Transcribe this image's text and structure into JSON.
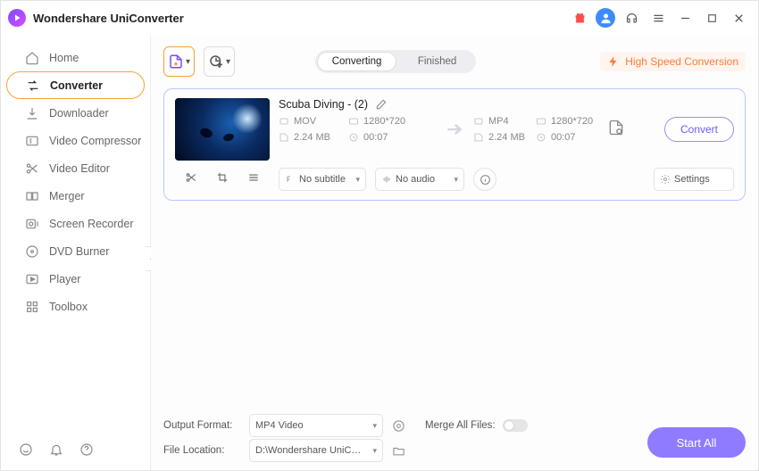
{
  "app": {
    "title": "Wondershare UniConverter"
  },
  "sidebar": {
    "items": [
      {
        "label": "Home"
      },
      {
        "label": "Converter"
      },
      {
        "label": "Downloader"
      },
      {
        "label": "Video Compressor"
      },
      {
        "label": "Video Editor"
      },
      {
        "label": "Merger"
      },
      {
        "label": "Screen Recorder"
      },
      {
        "label": "DVD Burner"
      },
      {
        "label": "Player"
      },
      {
        "label": "Toolbox"
      }
    ]
  },
  "tabs": {
    "converting": "Converting",
    "finished": "Finished"
  },
  "hsc": "High Speed Conversion",
  "file": {
    "title": "Scuba Diving - (2)",
    "in": {
      "format": "MOV",
      "resolution": "1280*720",
      "size": "2.24 MB",
      "duration": "00:07"
    },
    "out": {
      "format": "MP4",
      "resolution": "1280*720",
      "size": "2.24 MB",
      "duration": "00:07"
    },
    "subtitle": "No subtitle",
    "audio": "No audio",
    "settings": "Settings",
    "convert": "Convert"
  },
  "footer": {
    "output_format_label": "Output Format:",
    "output_format_value": "MP4 Video",
    "file_location_label": "File Location:",
    "file_location_value": "D:\\Wondershare UniConverter",
    "merge_label": "Merge All Files:",
    "start_all": "Start All"
  }
}
